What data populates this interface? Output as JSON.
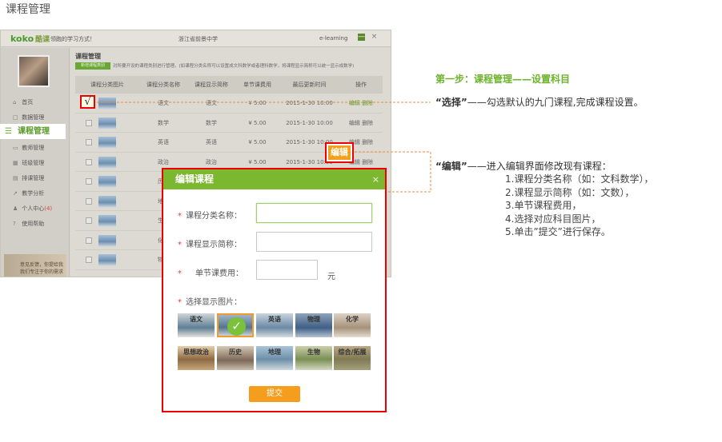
{
  "page_title": "课程管理",
  "app": {
    "logo_brand": "koko",
    "logo_cn": "酷课",
    "slogan": "领跑的学习方式！",
    "school": "浙江省前景中学",
    "elearning": "e-learning",
    "minimize": "—",
    "close": "×",
    "nav": [
      {
        "icon": "⌂",
        "label": "首页"
      },
      {
        "icon": "□",
        "label": "数据管理"
      },
      {
        "icon": "≡",
        "label": "课程管理"
      },
      {
        "icon": "▭",
        "label": "教师管理"
      },
      {
        "icon": "▦",
        "label": "班级管理"
      },
      {
        "icon": "▤",
        "label": "排课管理"
      },
      {
        "icon": "↗",
        "label": "教学分析"
      },
      {
        "icon": "♟",
        "label": "个人中心",
        "badge": "(4)"
      },
      {
        "icon": "?",
        "label": "使用帮助"
      }
    ],
    "banner_text_1": "意见反馈，你提给我",
    "banner_text_2": "我们专注于你的需求",
    "main_title": "课程管理",
    "add_button": "新增课程类别",
    "hint": "对所要开设的课程类别进行管理。(如课程分类名称可以设置成文科数学或者理科数学，将课程显示简称可以统一显示成数学)",
    "table": {
      "headers": [
        "课程分类图片",
        "课程分类名称",
        "课程显示简称",
        "单节课费用",
        "最后更新时间",
        "操作"
      ],
      "rows": [
        {
          "name": "语文",
          "short": "语文",
          "fee": "¥ 5.00",
          "time": "2015-1-30  10:00",
          "edit": "编辑",
          "del": "删除"
        },
        {
          "name": "数学",
          "short": "数学",
          "fee": "¥ 5.00",
          "time": "2015-1-30  10:00",
          "edit": "编辑",
          "del": "删除"
        },
        {
          "name": "英语",
          "short": "英语",
          "fee": "¥ 5.00",
          "time": "2015-1-30  10:00",
          "edit": "编辑",
          "del": "删除"
        },
        {
          "name": "政治",
          "short": "政治",
          "fee": "¥ 5.00",
          "time": "2015-1-30  10:00",
          "edit": "编辑",
          "del": "删除"
        },
        {
          "name": "历史",
          "short": "",
          "fee": "",
          "time": "",
          "edit": "",
          "del": ""
        },
        {
          "name": "地理",
          "short": "",
          "fee": "",
          "time": "",
          "edit": "",
          "del": ""
        },
        {
          "name": "生物",
          "short": "",
          "fee": "",
          "time": "",
          "edit": "",
          "del": ""
        },
        {
          "name": "化学",
          "short": "",
          "fee": "",
          "time": "",
          "edit": "",
          "del": ""
        },
        {
          "name": "物理",
          "short": "",
          "fee": "",
          "time": "",
          "edit": "",
          "del": ""
        }
      ]
    }
  },
  "callouts": {
    "check_mark": "√",
    "edit_button": "编辑"
  },
  "instructions": {
    "step_title": "第一步：课程管理——设置科目",
    "step1_key": "“选择”",
    "step1_text": "——勾选默认的九门课程,完成课程设置。",
    "step2_key": "“编辑”",
    "step2_text": "——进入编辑界面修改现有课程：",
    "step2_items": [
      "1.课程分类名称（如：文科数学），",
      "2.课程显示简称（如：文数），",
      "3.单节课程费用，",
      "4.选择对应科目图片，",
      "5.单击”提交”进行保存。"
    ]
  },
  "modal": {
    "title": "编辑课程",
    "close": "×",
    "field_category_label": "课程分类名称：",
    "field_short_label": "课程显示简称：",
    "field_fee_label": "单节课费用：",
    "fee_unit": "元",
    "field_category_value": "",
    "field_short_value": "",
    "field_fee_value": "",
    "image_label": "选择显示图片：",
    "images_row1": [
      "语文",
      "",
      "英语",
      "物理",
      "化学"
    ],
    "images_row2": [
      "思想政治",
      "历史",
      "地理",
      "生物",
      "综合/拓展"
    ],
    "selected_index": 1,
    "submit": "提交"
  },
  "colors": {
    "accent_green": "#7cb82f",
    "highlight_red": "#ee0000",
    "submit_orange": "#f59e1d"
  }
}
